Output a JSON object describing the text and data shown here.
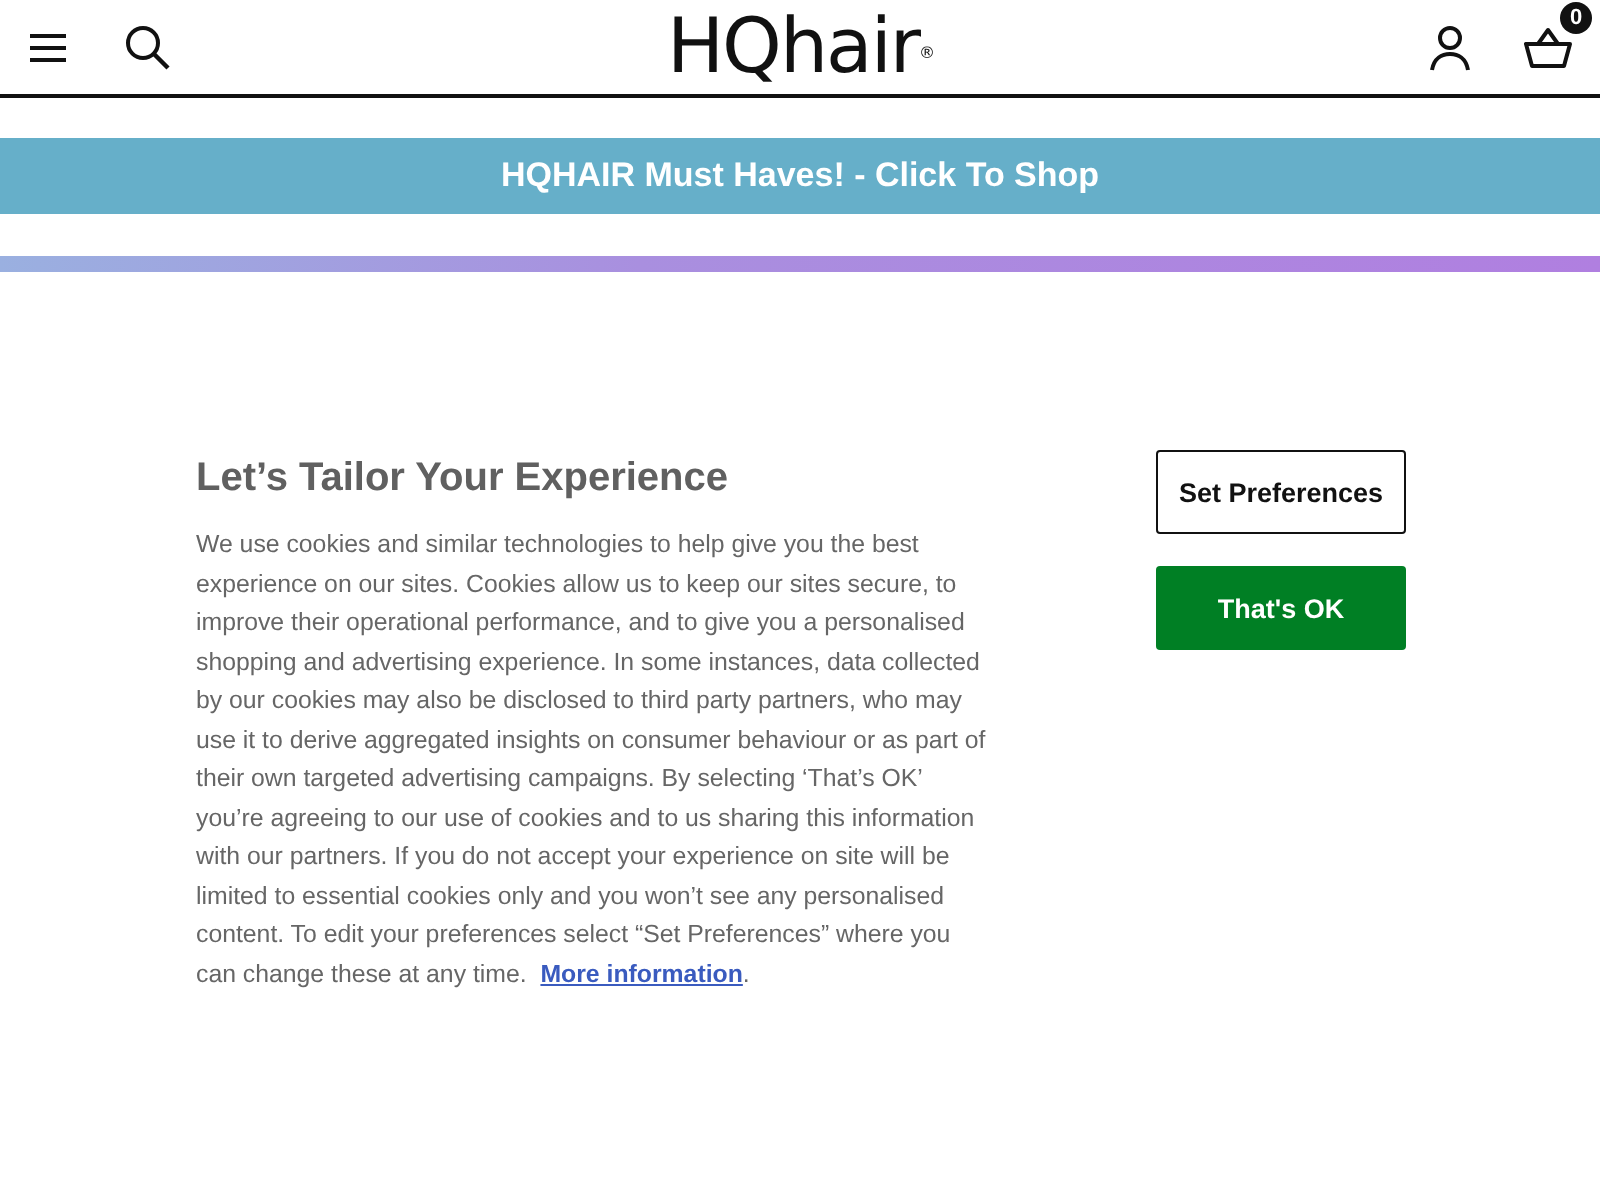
{
  "header": {
    "logo": "HQhair",
    "logo_mark": "®",
    "basket_count": "0"
  },
  "banner": {
    "text": "HQHAIR Must Haves! - Click To Shop"
  },
  "cookie_notice": {
    "title": "Let’s Tailor Your Experience",
    "body": "We use cookies and similar technologies to help give you the best experience on our sites. Cookies allow us to keep our sites secure, to improve their operational performance, and to give you a personalised shopping and advertising experience. In some instances, data collected by our cookies may also be disclosed to third party partners, who may use it to derive aggregated insights on consumer behaviour or as part of their own targeted advertising campaigns. By selecting ‘That’s OK’ you’re agreeing to our use of cookies and to us sharing this information with our partners. If you do not accept your experience on site will be limited to essential cookies only and you won’t see any personalised content. To edit your preferences select “Set Preferences” where you can change these at any time.",
    "link": "More information",
    "body_end": ".",
    "buttons": [
      {
        "label": "Set Preferences",
        "kind": "outline"
      },
      {
        "label": "That's OK",
        "kind": "primary"
      }
    ]
  }
}
